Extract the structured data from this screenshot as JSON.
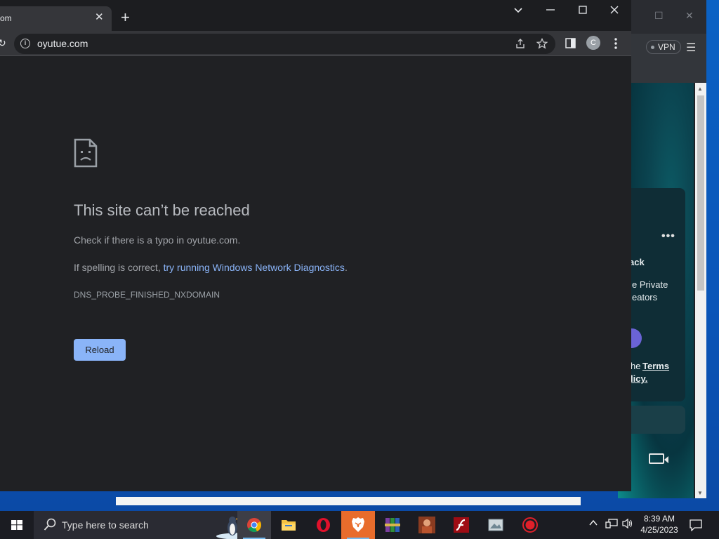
{
  "browser": {
    "tab_title": "om",
    "url": "oyutue.com"
  },
  "error": {
    "title": "This site can’t be reached",
    "line1": "Check if there is a typo in oyutue.com.",
    "line2_prefix": "If spelling is correct, ",
    "line2_link": "try running Windows Network Diagnostics",
    "line2_suffix": ".",
    "code": "DNS_PROBE_FINISHED_NXDOMAIN",
    "reload_label": "Reload"
  },
  "profile": {
    "initial": "C"
  },
  "back_window": {
    "vpn_label": "VPN",
    "text_ack": "ack",
    "text_private": "e Private",
    "text_eators": "eators",
    "text_he": "he",
    "text_terms": "Terms",
    "text_licy": "licy."
  },
  "taskbar": {
    "search_placeholder": "Type here to search",
    "time": "8:39 AM",
    "date": "4/25/2023"
  },
  "colors": {
    "chrome_bg": "#202124",
    "link": "#8ab4f8",
    "taskbar": "#1b1c22"
  }
}
